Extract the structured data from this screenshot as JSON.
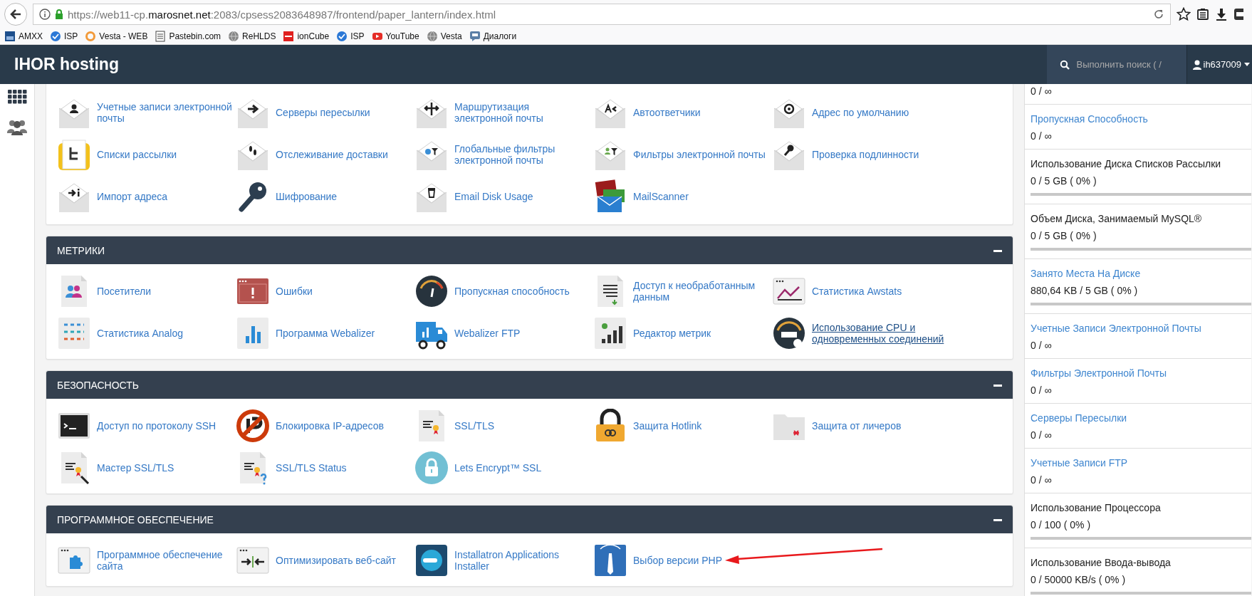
{
  "browser": {
    "url": [
      {
        "text": "https://web11-cp.",
        "emphasis": false
      },
      {
        "text": "marosnet.net",
        "emphasis": true
      },
      {
        "text": ":2083/cpsess2083648987/frontend/paper_lantern/index.html",
        "emphasis": false
      }
    ],
    "bookmarks": [
      {
        "label": "AMXX"
      },
      {
        "label": "ISP"
      },
      {
        "label": "Vesta - WEB"
      },
      {
        "label": "Pastebin.com"
      },
      {
        "label": "ReHLDS"
      },
      {
        "label": "ionCube"
      },
      {
        "label": "ISP"
      },
      {
        "label": "YouTube"
      },
      {
        "label": "Vesta"
      },
      {
        "label": "Диалоги"
      }
    ]
  },
  "header": {
    "logo": "IHOR hosting",
    "search": {
      "placeholder": "Выполнить поиск ( /"
    },
    "user": "ih637009"
  },
  "sections": [
    {
      "items": [
        {
          "label": "Учетные записи электронной почты",
          "hovered": false
        },
        {
          "label": "Серверы пересылки",
          "hovered": false
        },
        {
          "label": "Маршрутизация электронной почты",
          "hovered": false
        },
        {
          "label": "Автоответчики",
          "hovered": false
        },
        {
          "label": "Адрес по умолчанию",
          "hovered": false
        },
        {
          "label": "Списки рассылки",
          "hovered": false
        },
        {
          "label": "Отслеживание доставки",
          "hovered": false
        },
        {
          "label": "Глобальные фильтры электронной почты",
          "hovered": false
        },
        {
          "label": "Фильтры электронной почты",
          "hovered": false
        },
        {
          "label": "Проверка подлинности",
          "hovered": false
        },
        {
          "label": "Импорт адреса",
          "hovered": false
        },
        {
          "label": "Шифрование",
          "hovered": false
        },
        {
          "label": "Email Disk Usage",
          "hovered": false
        },
        {
          "label": "MailScanner",
          "hovered": false
        }
      ]
    },
    {
      "title": "МЕТРИКИ",
      "items": [
        {
          "label": "Посетители",
          "hovered": false
        },
        {
          "label": "Ошибки",
          "hovered": false
        },
        {
          "label": "Пропускная способность",
          "hovered": false
        },
        {
          "label": "Доступ к необработанным данным",
          "hovered": false
        },
        {
          "label": "Статистика Awstats",
          "hovered": false
        },
        {
          "label": "Статистика Analog",
          "hovered": false
        },
        {
          "label": "Программа Webalizer",
          "hovered": false
        },
        {
          "label": "Webalizer FTP",
          "hovered": false
        },
        {
          "label": "Редактор метрик",
          "hovered": false
        },
        {
          "label": "Использование CPU и одновременных соединений",
          "hovered": true
        }
      ]
    },
    {
      "title": "БЕЗОПАСНОСТЬ",
      "items": [
        {
          "label": "Доступ по протоколу SSH",
          "hovered": false
        },
        {
          "label": "Блокировка IP-адресов",
          "hovered": false
        },
        {
          "label": "SSL/TLS",
          "hovered": false
        },
        {
          "label": "Защита Hotlink",
          "hovered": false
        },
        {
          "label": "Защита от личеров",
          "hovered": false
        },
        {
          "label": "Мастер SSL/TLS",
          "hovered": false
        },
        {
          "label": "SSL/TLS Status",
          "hovered": false
        },
        {
          "label": "Lets Encrypt™ SSL",
          "hovered": false
        }
      ]
    },
    {
      "title": "ПРОГРАММНОЕ ОБЕСПЕЧЕНИЕ",
      "items": [
        {
          "label": "Программное обеспечение сайта",
          "hovered": false
        },
        {
          "label": "Оптимизировать веб-сайт",
          "hovered": false
        },
        {
          "label": "Installatron Applications Installer",
          "hovered": false
        },
        {
          "label": "Выбор версии PHP",
          "hovered": false
        }
      ]
    }
  ],
  "stats": [
    {
      "value": "0 / ∞"
    },
    {
      "title": "Пропускная Способность",
      "link": true,
      "value": "0 / ∞"
    },
    {
      "title": "Использование Диска Списков Рассылки",
      "link": false,
      "value": "0 / 5 GB ( 0% )",
      "level": 0
    },
    {
      "title": "Объем Диска, Занимаемый MySQL®",
      "link": false,
      "value": "0 / 5 GB ( 0% )",
      "level": 0
    },
    {
      "title": "Занято Места На Диске",
      "link": true,
      "value": "880,64 KB / 5 GB ( 0% )",
      "level": 0
    },
    {
      "title": "Учетные Записи Электронной Почты",
      "link": true,
      "value": "0 / ∞"
    },
    {
      "title": "Фильтры Электронной Почты",
      "link": true,
      "value": "0 / ∞"
    },
    {
      "title": "Серверы Пересылки",
      "link": true,
      "value": "0 / ∞"
    },
    {
      "title": "Учетные Записи FTP",
      "link": true,
      "value": "0 / ∞"
    },
    {
      "title": "Использование Процессора",
      "link": false,
      "value": "0 / 100 ( 0% )",
      "level": 0
    },
    {
      "title": "Использование Ввода-вывода",
      "link": false,
      "value": "0 / 50000 KB/s ( 0% )",
      "level": 0
    }
  ],
  "annotation": {
    "kind": "arrow"
  }
}
